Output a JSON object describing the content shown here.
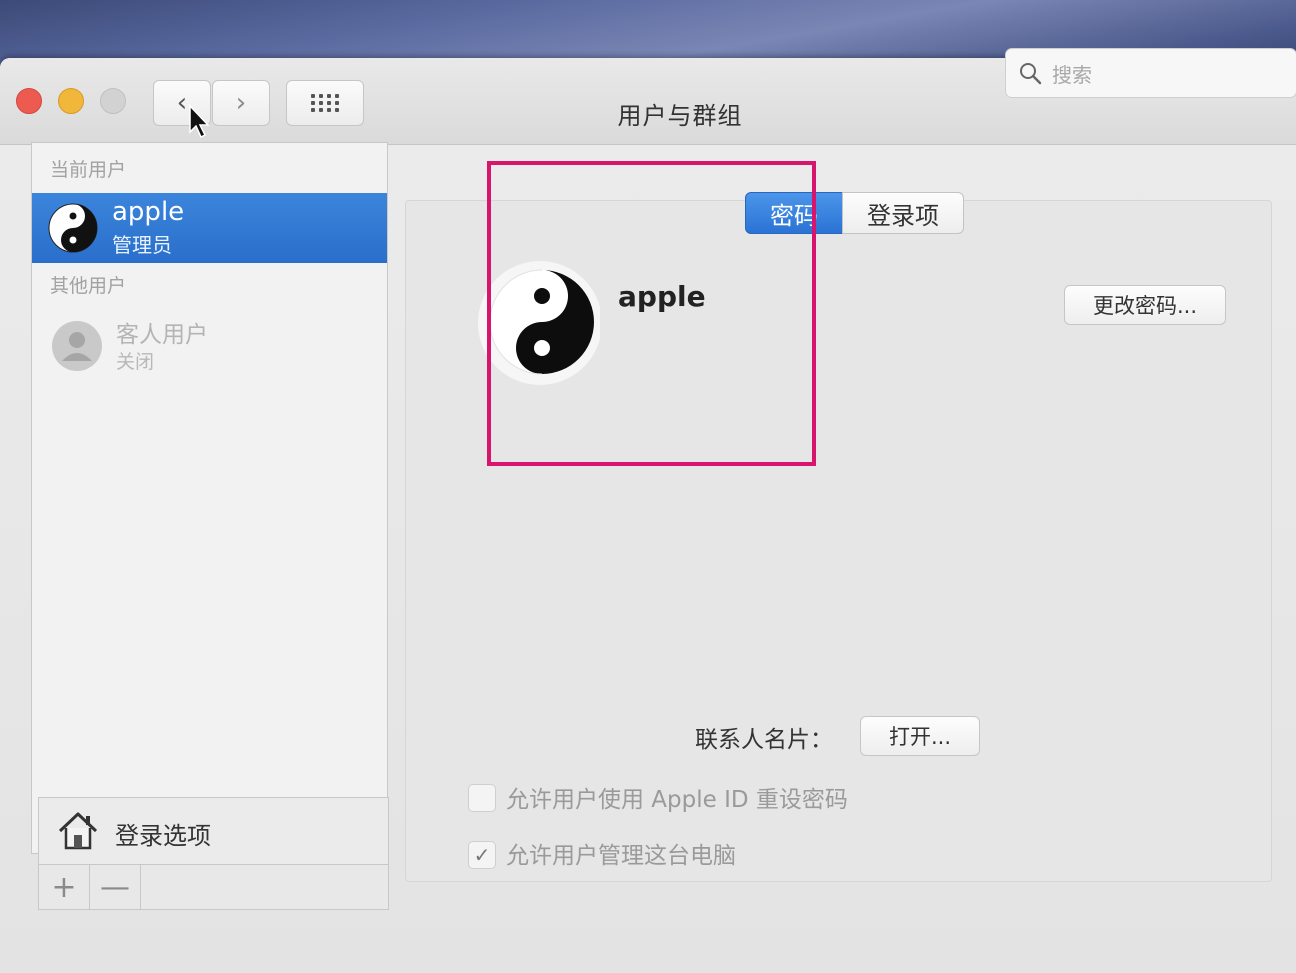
{
  "window": {
    "title": "用户与群组",
    "search_placeholder": "搜索"
  },
  "sidebar": {
    "section_current": "当前用户",
    "current_user": {
      "name": "apple",
      "role": "管理员"
    },
    "section_other": "其他用户",
    "guest_user": {
      "name": "客人用户",
      "status": "关闭"
    },
    "login_options_label": "登录选项",
    "add_label": "+",
    "remove_label": "—"
  },
  "main": {
    "tabs": [
      {
        "label": "密码",
        "selected": true
      },
      {
        "label": "登录项",
        "selected": false
      }
    ],
    "account_name": "apple",
    "change_password_button": "更改密码...",
    "contact_card_label": "联系人名片：",
    "open_button": "打开...",
    "checkboxes": [
      {
        "label": "允许用户使用 Apple ID 重设密码",
        "checked": false
      },
      {
        "label": "允许用户管理这台电脑",
        "checked": true
      }
    ]
  },
  "colors": {
    "selection_blue": "#2a6fcb",
    "highlight_box": "#d8156d"
  }
}
